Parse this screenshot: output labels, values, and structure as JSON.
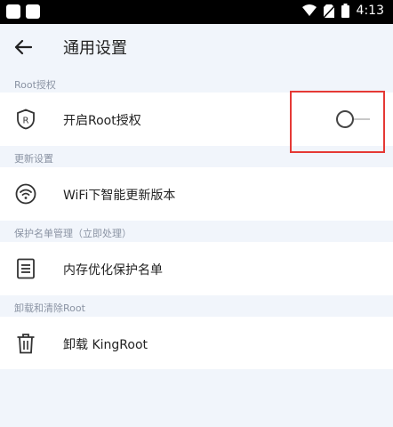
{
  "status_bar": {
    "time": "4:13"
  },
  "header": {
    "title": "通用设置"
  },
  "sections": [
    {
      "header": "Root授权",
      "item": {
        "label": "开启Root授权",
        "icon": "root-shield-icon",
        "toggle_on": false
      }
    },
    {
      "header": "更新设置",
      "item": {
        "label": "WiFi下智能更新版本",
        "icon": "wifi-icon"
      }
    },
    {
      "header": "保护名单管理（立即处理）",
      "item": {
        "label": "内存优化保护名单",
        "icon": "list-document-icon"
      }
    },
    {
      "header": "卸载和清除Root",
      "item": {
        "label": "卸载 KingRoot",
        "icon": "trash-icon"
      }
    }
  ],
  "colors": {
    "background": "#f1f5fb",
    "highlight": "#e53935",
    "section_text": "#8a93a3"
  }
}
